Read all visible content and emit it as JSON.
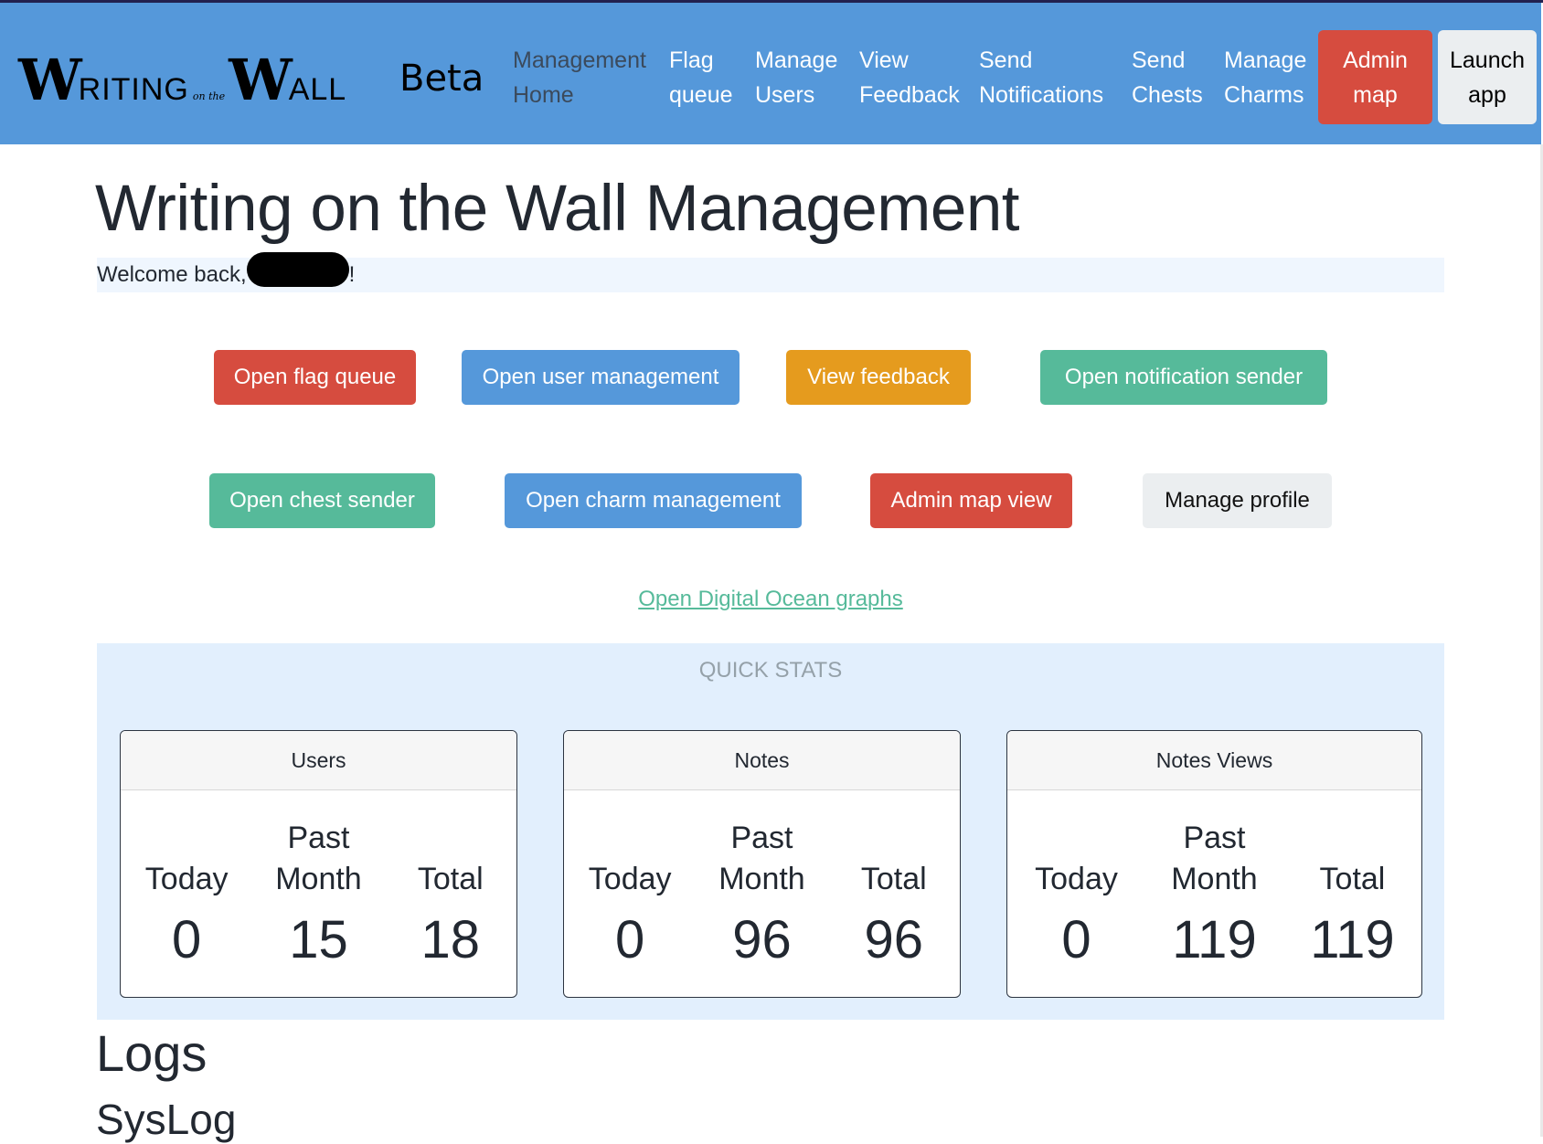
{
  "navbar": {
    "logo_text": {
      "w1": "W",
      "rest1": "RITING",
      "mid": "on the",
      "w2": "W",
      "rest2": "ALL"
    },
    "beta_label": "Beta",
    "links": [
      {
        "line1": "Management",
        "line2": "Home"
      },
      {
        "line1": "Flag",
        "line2": "queue"
      },
      {
        "line1": "Manage",
        "line2": "Users"
      },
      {
        "line1": "View",
        "line2": "Feedback"
      },
      {
        "line1": "Send",
        "line2": "Notifications"
      },
      {
        "line1": "Send",
        "line2": "Chests"
      },
      {
        "line1": "Manage",
        "line2": "Charms"
      }
    ],
    "admin_map": {
      "line1": "Admin",
      "line2": "map"
    },
    "launch_app": {
      "line1": "Launch",
      "line2": "app"
    }
  },
  "page": {
    "title": "Writing on the Wall Management",
    "welcome_prefix": "Welcome back,",
    "welcome_suffix": "!"
  },
  "actions": {
    "flag_queue": "Open flag queue",
    "user_management": "Open user management",
    "feedback": "View feedback",
    "notification_sender": "Open notification sender",
    "chest_sender": "Open chest sender",
    "charm_management": "Open charm management",
    "admin_map_view": "Admin map view",
    "manage_profile": "Manage profile"
  },
  "do_graphs_link": "Open Digital Ocean graphs",
  "quick_stats": {
    "title": "QUICK STATS",
    "labels": {
      "today": "Today",
      "past": "Past",
      "month": "Month",
      "total": "Total"
    },
    "cards": [
      {
        "title": "Users",
        "today": "0",
        "past_month": "15",
        "total": "18"
      },
      {
        "title": "Notes",
        "today": "0",
        "past_month": "96",
        "total": "96"
      },
      {
        "title": "Notes Views",
        "today": "0",
        "past_month": "119",
        "total": "119"
      }
    ]
  },
  "logs": {
    "heading": "Logs",
    "subheading": "SysLog"
  },
  "colors": {
    "navbar": "#5598da",
    "danger": "#d64c3f",
    "primary": "#5598da",
    "warning": "#e59b1e",
    "success": "#56ba9a",
    "light": "#ebeef0",
    "stats_bg": "#e2effd"
  }
}
